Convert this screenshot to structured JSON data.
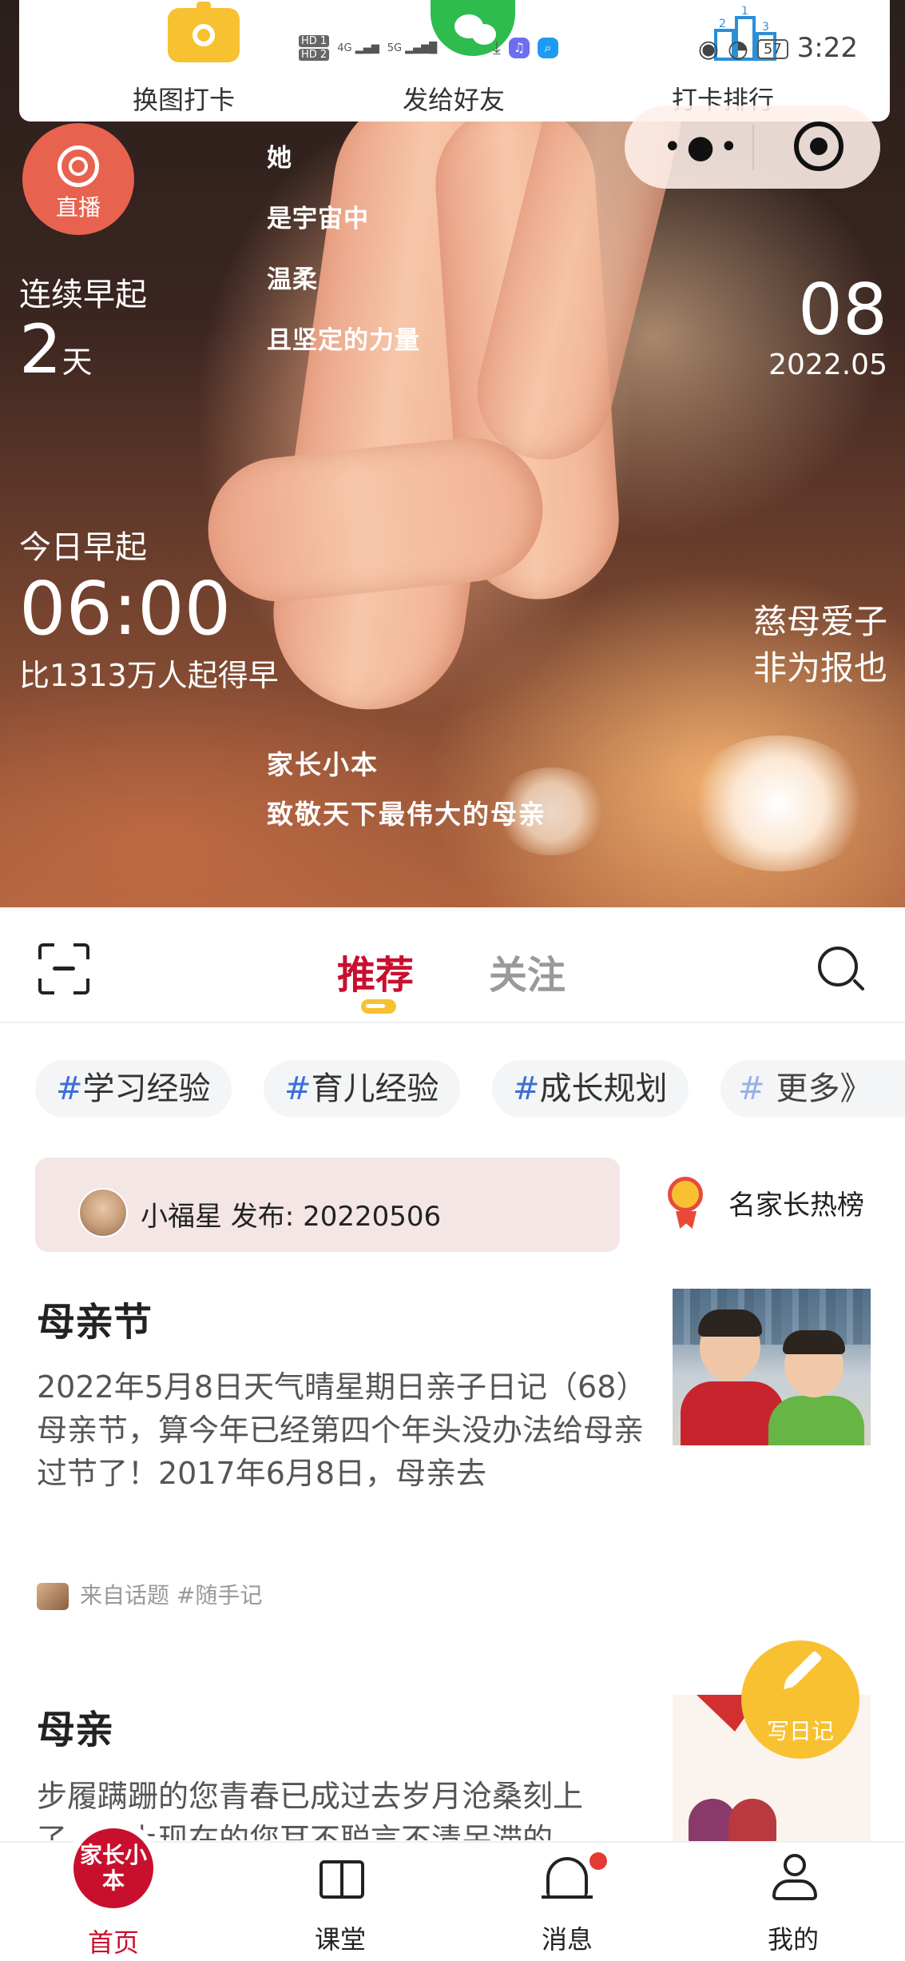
{
  "status_bar": {
    "network_badges": [
      "HD 1",
      "HD 2",
      "4G",
      "5G"
    ],
    "battery": "57",
    "time": "3:22"
  },
  "top_actions": {
    "change_image": "换图打卡",
    "send_friend": "发给好友",
    "ranking": "打卡排行"
  },
  "live": {
    "label": "直播"
  },
  "hero": {
    "streak_label": "连续早起",
    "streak_value": "2",
    "streak_unit": "天",
    "poem": [
      "她",
      "是宇宙中",
      "温柔",
      "且坚定的力量"
    ],
    "day": "08",
    "year_month": "2022.05",
    "today_label": "今日早起",
    "today_time": "06:00",
    "rank_text": "比1313万人起得早",
    "quote_line1": "慈母爱子",
    "quote_line2": "非为报也",
    "brand_line1": "家长小本",
    "brand_line2": "致敬天下最伟大的母亲"
  },
  "tabs": {
    "recommend": "推荐",
    "follow": "关注"
  },
  "topics": [
    {
      "hash": "#",
      "label": "学习经验"
    },
    {
      "hash": "#",
      "label": "育儿经验"
    },
    {
      "hash": "#",
      "label": "成长规划"
    },
    {
      "hash": "#",
      "label": "更多》"
    }
  ],
  "publish": {
    "text": "小福星 发布: 20220506"
  },
  "famous": {
    "label": "名家长热榜"
  },
  "posts": [
    {
      "title": "母亲节",
      "body": "2022年5月8日天气晴星期日亲子日记（68）母亲节，算今年已经第四个年头没办法给母亲过节了！2017年6月8日，母亲去",
      "source_prefix": "来自话题",
      "source_tag": "#随手记"
    },
    {
      "title": "母亲",
      "body": "步履蹒跚的您青春已成过去岁月沧桑刻上了……上现在的您耳不聪言不清呆滞的"
    }
  ],
  "write_button": "写日记",
  "bottom_nav": {
    "home": "首页",
    "home_logo": "家长小本",
    "class": "课堂",
    "messages": "消息",
    "mine": "我的"
  },
  "colors": {
    "accent_red": "#c8102e",
    "yellow": "#f7c131",
    "topic_hash": "#3b6fd8",
    "live_badge": "#e8634f"
  }
}
